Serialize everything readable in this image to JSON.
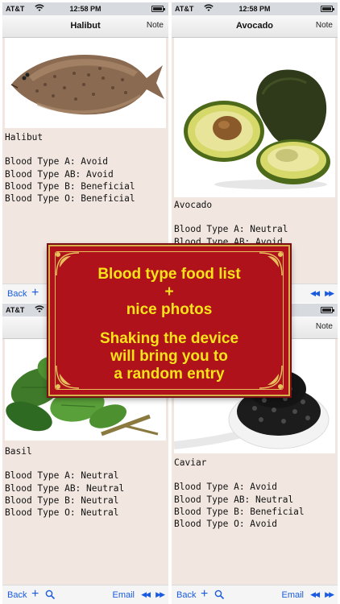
{
  "status": {
    "carrier": "AT&T",
    "time": "12:58 PM"
  },
  "panels": [
    {
      "title": "Halibut",
      "note_label": "Note",
      "name": "Halibut",
      "lines": [
        "Blood Type A: Avoid",
        "Blood Type AB: Avoid",
        "Blood Type B: Beneficial",
        "Blood Type O: Beneficial"
      ],
      "toolbar": {
        "back": "Back"
      }
    },
    {
      "title": "Avocado",
      "note_label": "Note",
      "name": "Avocado",
      "lines": [
        "Blood Type A: Neutral",
        "Blood Type AB: Avoid"
      ],
      "toolbar": {}
    },
    {
      "title": "",
      "note_label": "",
      "name": "Basil",
      "lines": [
        "Blood Type A: Neutral",
        "Blood Type AB: Neutral",
        "Blood Type B: Neutral",
        "Blood Type O: Neutral"
      ],
      "toolbar": {
        "back": "Back",
        "email": "Email"
      }
    },
    {
      "title": "",
      "note_label": "Note",
      "name": "Caviar",
      "lines": [
        "Blood Type A: Avoid",
        "Blood Type AB: Neutral",
        "Blood Type B: Beneficial",
        "Blood Type O: Avoid"
      ],
      "toolbar": {
        "back": "Back",
        "email": "Email"
      }
    }
  ],
  "promo": {
    "line1": "Blood type food list",
    "line2": "+",
    "line3": "nice photos",
    "line4": "Shaking the device",
    "line5": "will bring you to",
    "line6": "a random entry"
  },
  "icons": {
    "wifi": "wifi-icon",
    "battery": "battery-icon",
    "add": "plus-icon",
    "search": "search-icon",
    "prev": "rewind-icon",
    "next": "fast-forward-icon"
  },
  "colors": {
    "accent": "#1a5be0",
    "promo_bg": "#b0121b",
    "promo_text": "#f7e31a",
    "content_bg": "#f1e7e0"
  }
}
